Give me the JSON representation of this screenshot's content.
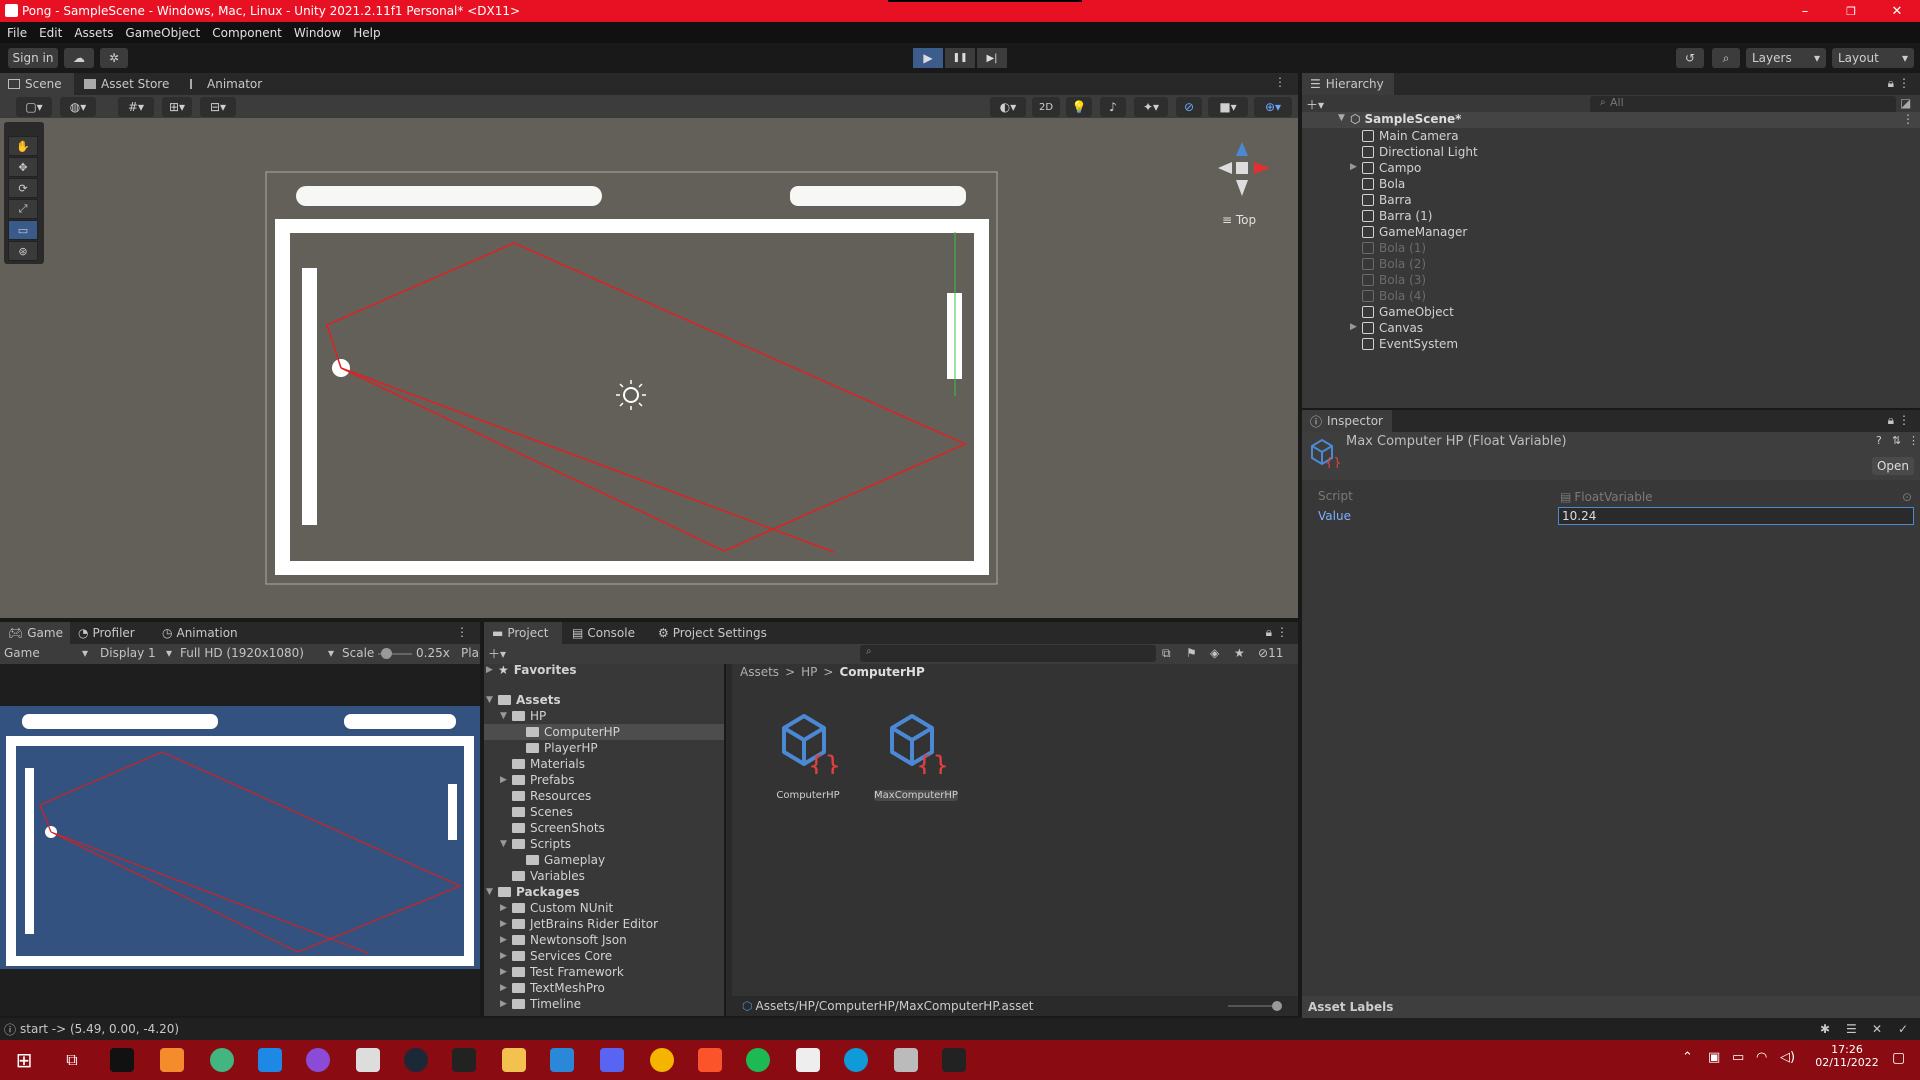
{
  "window": {
    "title": "Pong - SampleScene - Windows, Mac, Linux - Unity 2021.2.11f1 Personal* <DX11>",
    "min_glyph": "–",
    "max_glyph": "❐",
    "close_glyph": "✕"
  },
  "menu": [
    "File",
    "Edit",
    "Assets",
    "GameObject",
    "Component",
    "Window",
    "Help"
  ],
  "toolbar": {
    "sign_in": "Sign in",
    "layers": "Layers",
    "layout": "Layout",
    "play_glyph": "▶",
    "pause_glyph": "❚❚",
    "step_glyph": "▶|"
  },
  "scene_tabs": [
    "Scene",
    "Asset Store",
    "Animator"
  ],
  "scene_toolbar": {
    "mode_2d": "2D"
  },
  "scene_gizmo": {
    "label": "Top"
  },
  "hierarchy": {
    "tab": "Hierarchy",
    "search_placeholder": "All",
    "scene_name": "SampleScene*",
    "items": [
      {
        "label": "Main Camera",
        "dim": false
      },
      {
        "label": "Directional Light",
        "dim": false
      },
      {
        "label": "Campo",
        "dim": false
      },
      {
        "label": "Bola",
        "dim": false
      },
      {
        "label": "Barra",
        "dim": false
      },
      {
        "label": "Barra (1)",
        "dim": false
      },
      {
        "label": "GameManager",
        "dim": false
      },
      {
        "label": "Bola (1)",
        "dim": true
      },
      {
        "label": "Bola (2)",
        "dim": true
      },
      {
        "label": "Bola (3)",
        "dim": true
      },
      {
        "label": "Bola (4)",
        "dim": true
      },
      {
        "label": "GameObject",
        "dim": false
      },
      {
        "label": "Canvas",
        "dim": false
      },
      {
        "label": "EventSystem",
        "dim": false
      }
    ]
  },
  "inspector": {
    "tab": "Inspector",
    "title": "Max Computer HP (Float Variable)",
    "open_button": "Open",
    "script_label": "Script",
    "script_value": "FloatVariable",
    "value_label": "Value",
    "value": "10.24"
  },
  "game_tabs": [
    "Game",
    "Profiler",
    "Animation"
  ],
  "game_toolbar": {
    "mode": "Game",
    "display": "Display 1",
    "resolution": "Full HD (1920x1080)",
    "scale_label": "Scale",
    "scale_value": "0.25x",
    "play_label": "Pla"
  },
  "project_tabs": [
    "Project",
    "Console",
    "Project Settings"
  ],
  "project": {
    "hidden_count": "11",
    "favorites": "Favorites",
    "assets_root": "Assets",
    "breadcrumb": [
      "Assets",
      "HP",
      "ComputerHP"
    ],
    "breadcrumb_sep": ">",
    "tree": [
      {
        "label": "HP",
        "indent": 1,
        "expanded": true
      },
      {
        "label": "ComputerHP",
        "indent": 2,
        "selected": true
      },
      {
        "label": "PlayerHP",
        "indent": 2
      },
      {
        "label": "Materials",
        "indent": 1
      },
      {
        "label": "Prefabs",
        "indent": 1,
        "arrow": true
      },
      {
        "label": "Resources",
        "indent": 1
      },
      {
        "label": "Scenes",
        "indent": 1
      },
      {
        "label": "ScreenShots",
        "indent": 1
      },
      {
        "label": "Scripts",
        "indent": 1,
        "expanded": true
      },
      {
        "label": "Gameplay",
        "indent": 2
      },
      {
        "label": "Variables",
        "indent": 1
      }
    ],
    "packages_root": "Packages",
    "packages": [
      "Custom NUnit",
      "JetBrains Rider Editor",
      "Newtonsoft Json",
      "Services Core",
      "Test Framework",
      "TextMeshPro",
      "Timeline"
    ],
    "assets": [
      {
        "label": "ComputerHP",
        "selected": false
      },
      {
        "label": "MaxComputerHP",
        "selected": true
      }
    ],
    "path": "Assets/HP/ComputerHP/MaxComputerHP.asset",
    "asset_labels": "Asset Labels"
  },
  "status": {
    "message": "start -> (5.49, 0.00, -4.20)"
  },
  "taskbar": {
    "time": "17:26",
    "date": "02/11/2022"
  },
  "colors": {
    "titlebar": "#e81123",
    "taskbar": "#8b0b12",
    "scene_bg": "#636059",
    "game_bg": "#335280",
    "accent": "#4c89d4",
    "trajectory": "#e02020"
  }
}
